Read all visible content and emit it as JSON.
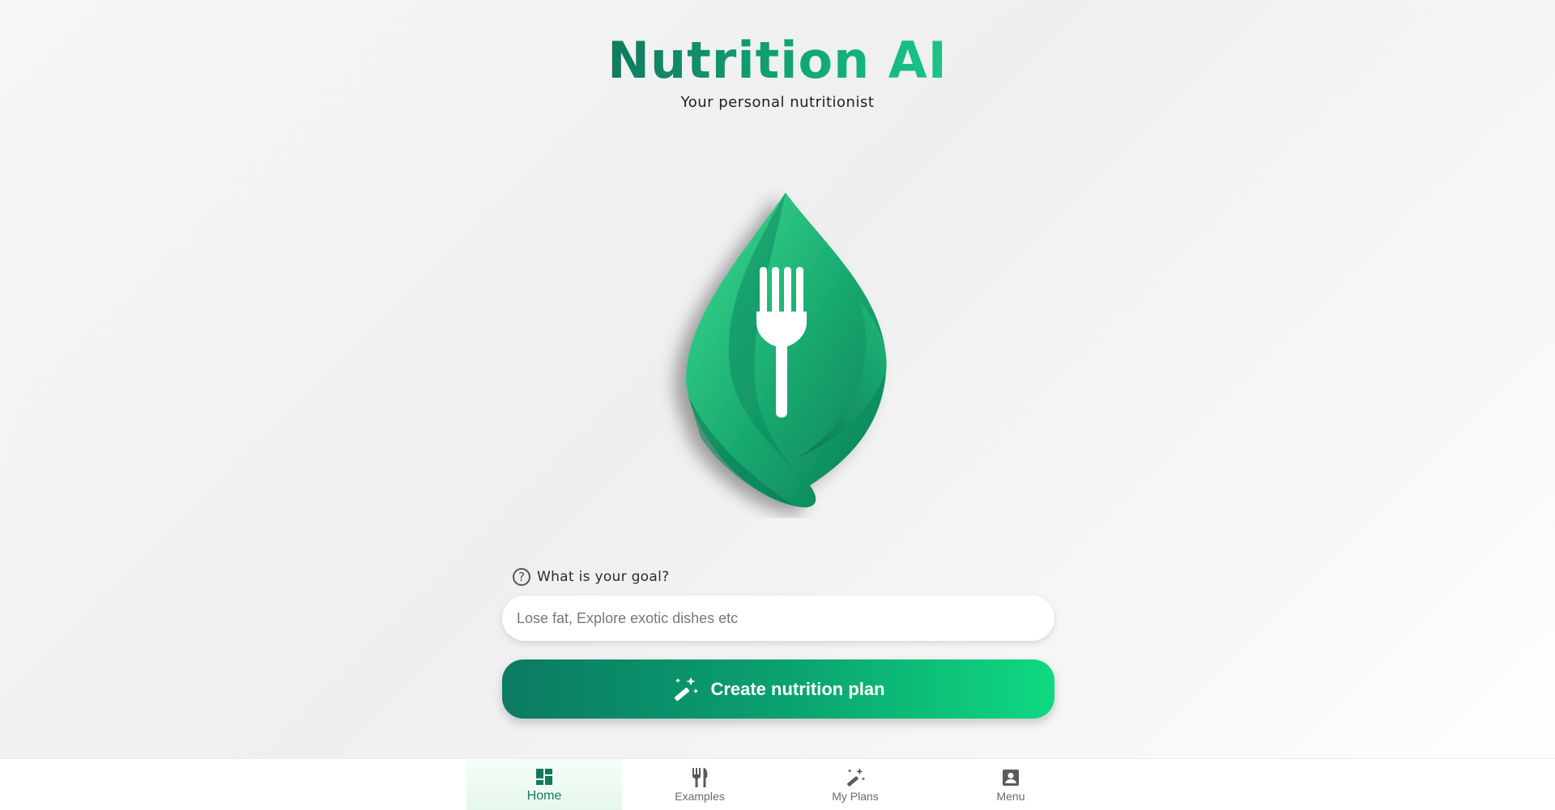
{
  "header": {
    "title": "Nutrition AI",
    "subtitle": "Your personal nutritionist"
  },
  "logo": {
    "icon": "leaf-fork-logo",
    "colors": {
      "leaf_dark": "#0a7c57",
      "leaf_light": "#35d889",
      "fork": "#ffffff"
    }
  },
  "goal": {
    "label": "What is your goal?",
    "help_icon": "question-circle-icon",
    "placeholder": "Lose fat, Explore exotic dishes etc",
    "value": ""
  },
  "create_button": {
    "label": "Create nutrition plan",
    "icon": "magic-wand-icon"
  },
  "bottom_nav": {
    "items": [
      {
        "label": "Home",
        "icon": "dashboard-icon",
        "active": true
      },
      {
        "label": "Examples",
        "icon": "fork-knife-icon",
        "active": false
      },
      {
        "label": "My Plans",
        "icon": "magic-wand-icon",
        "active": false
      },
      {
        "label": "Menu",
        "icon": "account-box-icon",
        "active": false
      }
    ]
  },
  "colors": {
    "brand_dark": "#0f7b5f",
    "brand_light": "#0fd981",
    "nav_active_text": "#127a5b"
  }
}
